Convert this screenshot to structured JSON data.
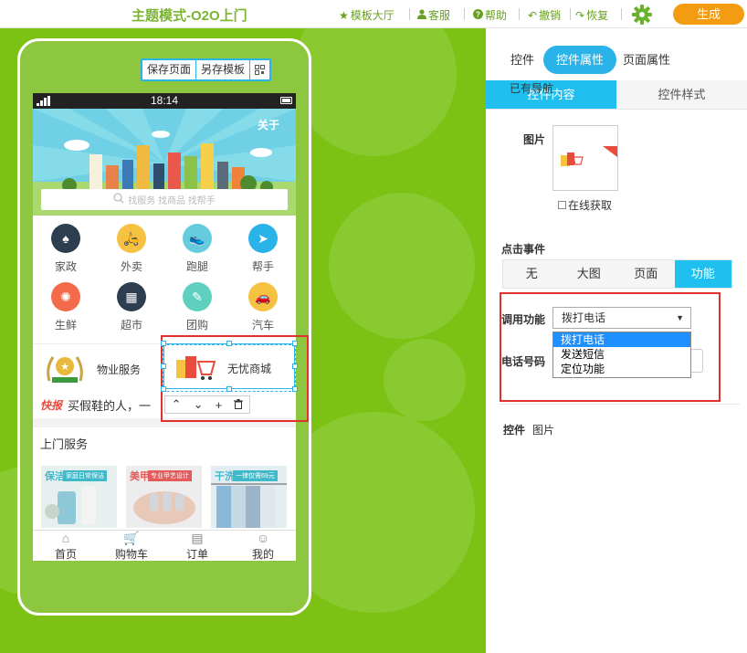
{
  "topbar": {
    "title": "主题模式-O2O上门",
    "items": [
      {
        "icon": "star-icon",
        "label": "模板大厅"
      },
      {
        "icon": "user-icon",
        "label": "客服"
      },
      {
        "icon": "help-icon",
        "label": "帮助"
      },
      {
        "icon": "undo-icon",
        "label": "撤销"
      },
      {
        "icon": "redo-icon",
        "label": "恢复"
      }
    ],
    "generate_label": "生成",
    "accent": "#7ab530",
    "generate_color": "#f39c12"
  },
  "phone_tools": {
    "save": "保存页面",
    "save_as": "另存模板",
    "qr_icon": "qr-icon"
  },
  "screen": {
    "time": "18:14",
    "banner_about": "关于",
    "search_placeholder": "找服务 找商品 找帮手",
    "grid": [
      {
        "label": "家政",
        "icon": "suit-icon",
        "color": "#2c3e50"
      },
      {
        "label": "外卖",
        "icon": "scooter-icon",
        "color": "#f5c242"
      },
      {
        "label": "跑腿",
        "icon": "shoe-icon",
        "color": "#66ccdd"
      },
      {
        "label": "帮手",
        "icon": "plane-icon",
        "color": "#2ab3e8"
      },
      {
        "label": "生鲜",
        "icon": "orange-icon",
        "color": "#f36b4a"
      },
      {
        "label": "超市",
        "icon": "store-icon",
        "color": "#2c3e50"
      },
      {
        "label": "团购",
        "icon": "tag-icon",
        "color": "#5fcfc0"
      },
      {
        "label": "汽车",
        "icon": "car-icon",
        "color": "#f5c242"
      }
    ],
    "service_left": "物业服务",
    "service_right": "无忧商城",
    "news_tag": "快报",
    "news_text": "买假鞋的人，一",
    "home_title": "上门服务",
    "cards": [
      {
        "label": "保洁",
        "sub": "家庭日常保洁",
        "color": "#3fb8c9"
      },
      {
        "label": "美甲",
        "sub": "专业甲艺设计",
        "color": "#e55a5a"
      },
      {
        "label": "干洗",
        "sub": "一律仅需69元",
        "color": "#3fb8c9"
      }
    ],
    "tabs": [
      {
        "label": "首页",
        "icon": "home-icon"
      },
      {
        "label": "购物车",
        "icon": "cart-icon"
      },
      {
        "label": "订单",
        "icon": "order-icon"
      },
      {
        "label": "我的",
        "icon": "profile-icon"
      }
    ]
  },
  "panel": {
    "tabs": [
      "控件",
      "控件属性",
      "页面属性"
    ],
    "nav_overlay": "已有导航",
    "subtabs": [
      "控件内容",
      "控件样式"
    ],
    "image_label": "图片",
    "online_label": "在线获取",
    "click_event_label": "点击事件",
    "event_tabs": [
      "无",
      "大图",
      "页面",
      "功能"
    ],
    "function_label": "调用功能",
    "function_value": "拨打电话",
    "function_options": [
      "拨打电话",
      "发送短信",
      "定位功能"
    ],
    "phone_label": "电话号码",
    "crumb": [
      "控件",
      "图片"
    ]
  }
}
